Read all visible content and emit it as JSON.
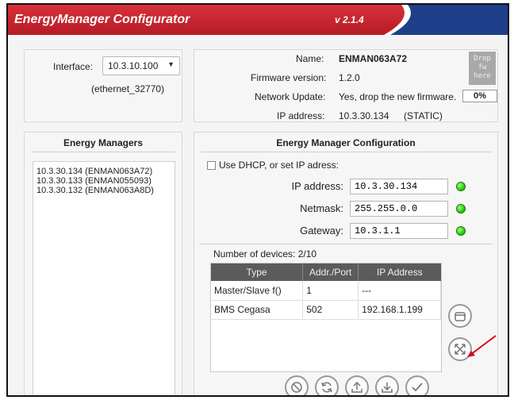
{
  "app": {
    "title": "EnergyManager Configurator",
    "version": "v 2.1.4"
  },
  "interface": {
    "label": "Interface:",
    "selected": "10.3.10.100",
    "subtitle": "(ethernet_32770)"
  },
  "device_info": {
    "name_label": "Name:",
    "name_value": "ENMAN063A72",
    "firmware_label": "Firmware version:",
    "firmware_value": "1.2.0",
    "network_update_label": "Network Update:",
    "network_update_value": "Yes, drop the new firmware.",
    "ip_label": "IP address:",
    "ip_value": "10.3.30.134",
    "ip_mode": "(STATIC)",
    "drop_target": "Drop fw here",
    "progress_text": "0%"
  },
  "energy_managers": {
    "title": "Energy Managers",
    "items": [
      "10.3.30.134 (ENMAN063A72)",
      "10.3.30.133 (ENMAN055093)",
      "10.3.30.132 (ENMAN063A8D)"
    ]
  },
  "configuration": {
    "title": "Energy Manager Configuration",
    "dhcp_label": "Use DHCP, or set IP adress:",
    "ip_label": "IP address:",
    "ip_value": "10.3.30.134",
    "netmask_label": "Netmask:",
    "netmask_value": "255.255.0.0",
    "gateway_label": "Gateway:",
    "gateway_value": "10.3.1.1",
    "devices_count": "Number of devices: 2/10",
    "table": {
      "columns": [
        "Type",
        "Addr./Port",
        "IP Address"
      ],
      "rows": [
        [
          "Master/Slave f()",
          "1",
          "---"
        ],
        [
          "BMS Cegasa",
          "502",
          "192.168.1.199"
        ]
      ]
    }
  },
  "colors": {
    "title_bar": "#c8242f",
    "table_header": "#5b5b5b",
    "status_led": "#1bbf00",
    "annotation_arrow": "#d9001b"
  }
}
